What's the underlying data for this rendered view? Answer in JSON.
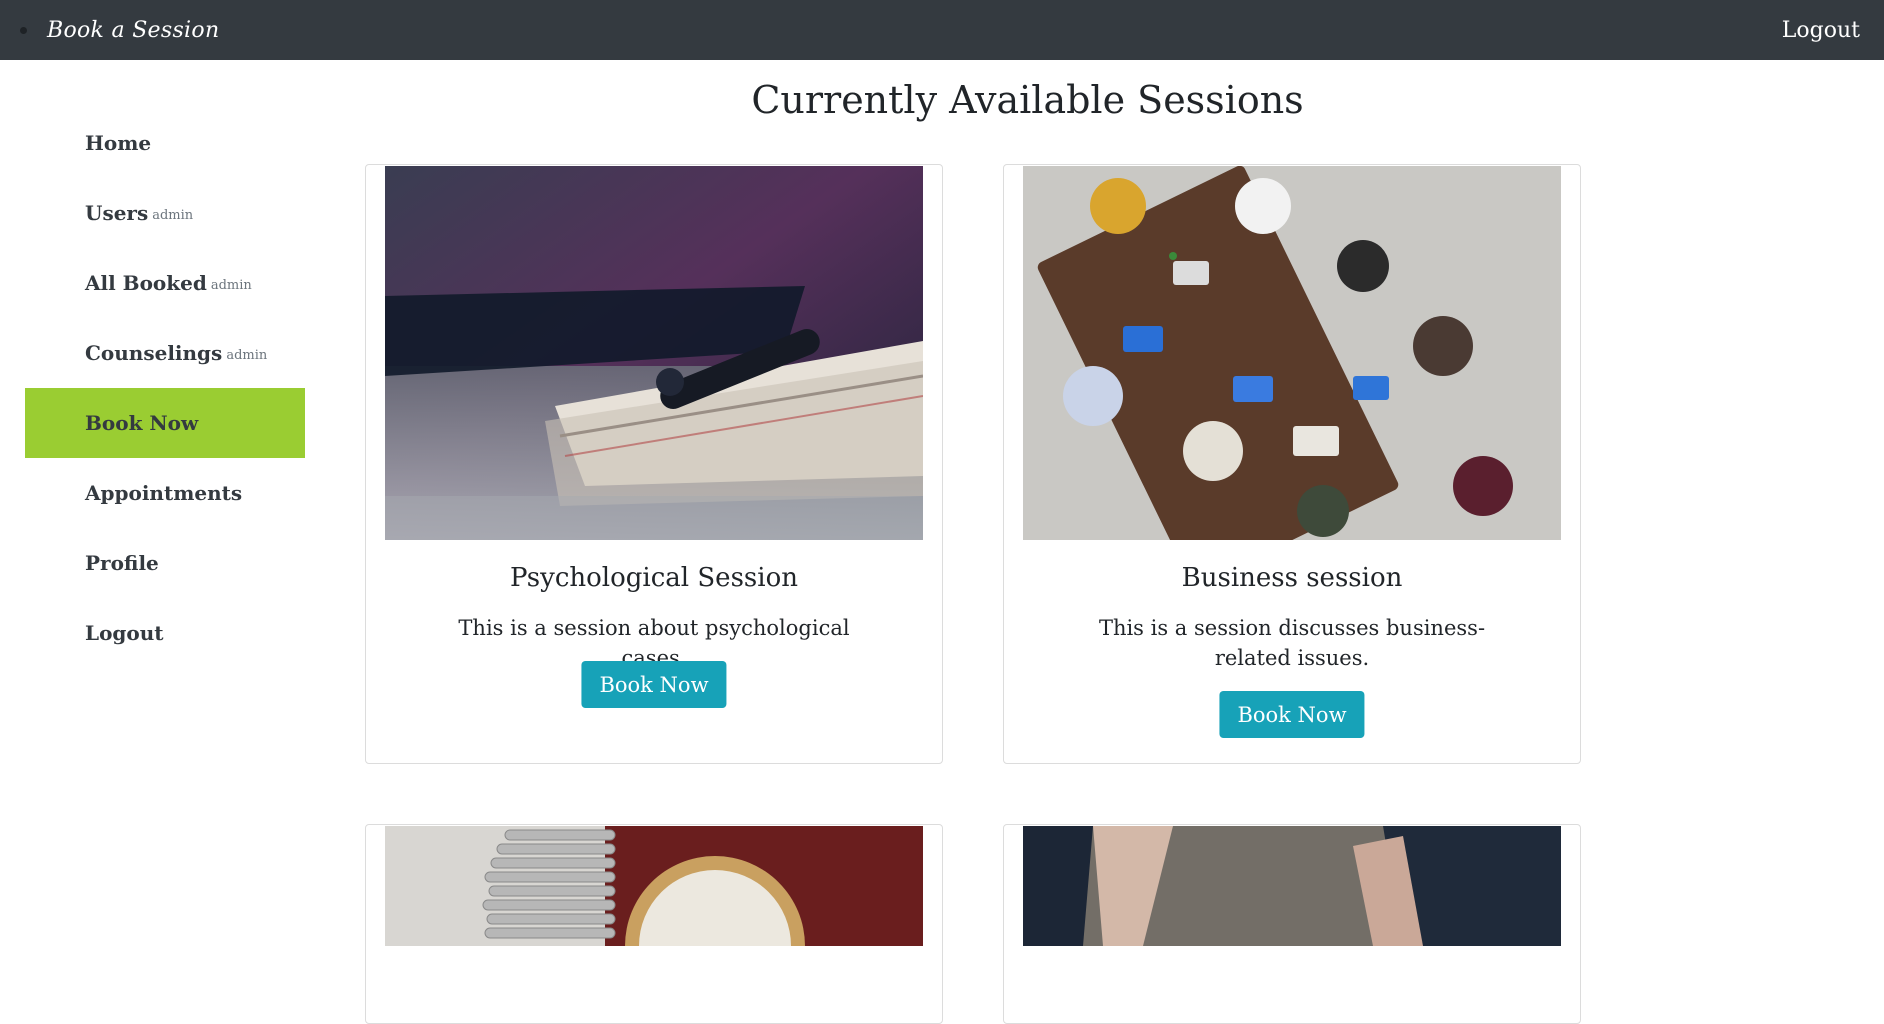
{
  "navbar": {
    "brand": "Book a Session",
    "logout": "Logout"
  },
  "sidebar": {
    "items": [
      {
        "label": "Home",
        "tag": ""
      },
      {
        "label": "Users",
        "tag": "admin"
      },
      {
        "label": "All Booked",
        "tag": "admin"
      },
      {
        "label": "Counselings",
        "tag": "admin"
      },
      {
        "label": "Book Now",
        "tag": "",
        "active": true
      },
      {
        "label": "Appointments",
        "tag": ""
      },
      {
        "label": "Profile",
        "tag": ""
      },
      {
        "label": "Logout",
        "tag": ""
      }
    ]
  },
  "main": {
    "title": "Currently Available Sessions",
    "cards": [
      {
        "title": "Psychological Session",
        "description": "This is a session about psychological cases.",
        "button": "Book Now",
        "image": "notebook-with-pen-photo"
      },
      {
        "title": "Business session",
        "description": "This is a session discusses business-related issues.",
        "button": "Book Now",
        "image": "business-meeting-overhead-photo"
      },
      {
        "image": "coins-and-clock-photo"
      },
      {
        "image": "people-walking-photo"
      }
    ]
  },
  "colors": {
    "navbar": "#343a40",
    "active": "#9acd32",
    "button": "#17a2b8"
  }
}
